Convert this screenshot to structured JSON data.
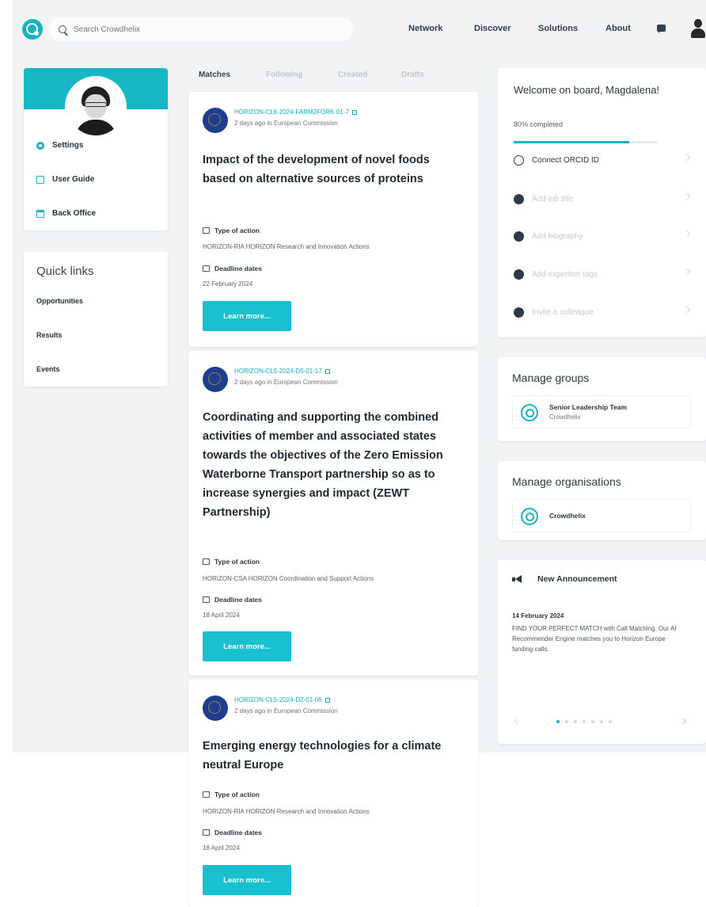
{
  "header": {
    "search_placeholder": "Search Crowdhelix",
    "nav": [
      "Network",
      "Discover",
      "Solutions",
      "About"
    ]
  },
  "sidebar": {
    "items": [
      {
        "label": "Settings",
        "icon": "gear-icon"
      },
      {
        "label": "User Guide",
        "icon": "book-icon"
      },
      {
        "label": "Back Office",
        "icon": "calendar-icon"
      }
    ]
  },
  "quick_links": {
    "title": "Quick links",
    "items": [
      "Opportunities",
      "Results",
      "Events"
    ]
  },
  "tabs": [
    "Matches",
    "Following",
    "Created",
    "Drafts"
  ],
  "opportunities": [
    {
      "code": "HORIZON-CL6-2024-FARM2FORK-01-7",
      "meta": "2 days ago in European Commission",
      "title": "Impact of the development of novel foods based on alternative sources of proteins",
      "type_label": "Type of action",
      "type_value": "HORIZON-RIA HORIZON Research and Innovation Actions",
      "deadline_label": "Deadline dates",
      "deadline_value": "22 February 2024",
      "button": "Learn more..."
    },
    {
      "code": "HORIZON-CL5-2024-D5-01-17",
      "meta": "2 days ago in European Commission",
      "title": "Coordinating and supporting the combined activities of member and associated states towards the objectives of the Zero Emission Waterborne Transport partnership so as to increase synergies and impact (ZEWT Partnership)",
      "type_label": "Type of action",
      "type_value": "HORIZON-CSA HORIZON Coordination and Support Actions",
      "deadline_label": "Deadline dates",
      "deadline_value": "18 April 2024",
      "button": "Learn more..."
    },
    {
      "code": "HORIZON-CL5-2024-D2-01-06",
      "meta": "2 days ago in European Commission",
      "title": "Emerging energy technologies for a climate neutral Europe",
      "type_label": "Type of action",
      "type_value": "HORIZON-RIA HORIZON Research and Innovation Actions",
      "deadline_label": "Deadline dates",
      "deadline_value": "18 April 2024",
      "button": "Learn more..."
    }
  ],
  "onboarding": {
    "title": "Welcome on board, Magdalena!",
    "progress_text": "80% completed",
    "progress_value": 0.8,
    "tasks": [
      {
        "label": "Connect ORCID ID",
        "done": false
      },
      {
        "label": "Add job title",
        "done": true
      },
      {
        "label": "Add biography",
        "done": true
      },
      {
        "label": "Add expertise tags",
        "done": true
      },
      {
        "label": "Invite a colleague",
        "done": true
      }
    ]
  },
  "manage_groups": {
    "title": "Manage groups",
    "item_name": "Senior Leadership Team",
    "item_sub": "Crowdhelix"
  },
  "manage_orgs": {
    "title": "Manage organisations",
    "item_name": "Crowdhelix"
  },
  "announcement": {
    "title": "New Announcement",
    "date": "14 February 2024",
    "body": "FIND YOUR PERFECT MATCH with Call Matching. Our AI Recommender Engine matches you to Horizon Europe funding calls.",
    "dots": 7,
    "active_dot": 0
  }
}
